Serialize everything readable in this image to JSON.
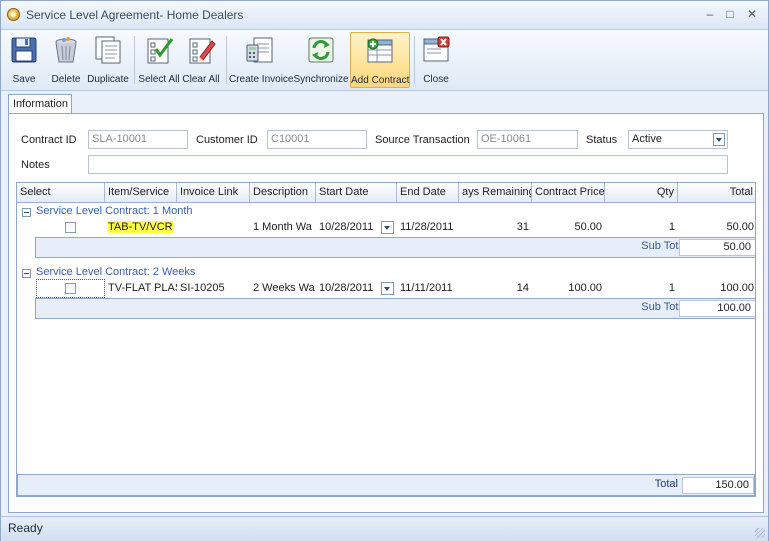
{
  "window": {
    "title": "Service Level Agreement- Home Dealers",
    "controls": {
      "minimize": "–",
      "maximize": "□",
      "close": "✕"
    }
  },
  "toolbar": {
    "buttons": [
      {
        "label": "Save",
        "icon": "save-icon"
      },
      {
        "label": "Delete",
        "icon": "trash-icon"
      },
      {
        "label": "Duplicate",
        "icon": "duplicate-icon"
      },
      {
        "label": "Select All",
        "icon": "select-all-icon"
      },
      {
        "label": "Clear All",
        "icon": "clear-all-icon"
      },
      {
        "label": "Create Invoice",
        "icon": "create-invoice-icon"
      },
      {
        "label": "Synchronize",
        "icon": "synchronize-icon"
      },
      {
        "label": "Add Contract",
        "icon": "add-contract-icon"
      },
      {
        "label": "Close",
        "icon": "close-form-icon"
      }
    ],
    "active": "Add Contract"
  },
  "tabs": [
    {
      "label": "Information"
    }
  ],
  "form": {
    "contract_id_label": "Contract ID",
    "contract_id": "SLA-10001",
    "customer_id_label": "Customer ID",
    "customer_id": "C10001",
    "source_transaction_label": "Source Transaction",
    "source_transaction": "OE-10061",
    "status_label": "Status",
    "status": "Active",
    "notes_label": "Notes",
    "notes": ""
  },
  "grid": {
    "columns": [
      "Select",
      "Item/Service",
      "Invoice Link",
      "Description",
      "Start Date",
      "End Date",
      "ays Remaining",
      "Contract Price",
      "Qty",
      "Total"
    ],
    "groups": [
      {
        "title": "Service Level Contract: 1 Month",
        "rows": [
          {
            "item": "TAB-TV/VCR",
            "invoice_link": "",
            "description": "1 Month Wa",
            "start_date": "10/28/2011",
            "end_date": "11/28/2011",
            "days_remaining": "31",
            "contract_price": "50.00",
            "qty": "1",
            "total": "50.00"
          }
        ],
        "subtotal_label": "Sub Total:",
        "subtotal": "50.00"
      },
      {
        "title": "Service Level Contract: 2 Weeks",
        "rows": [
          {
            "item": "TV-FLAT PLAS",
            "invoice_link": "SI-10205",
            "description": "2 Weeks Wa",
            "start_date": "10/28/2011",
            "end_date": "11/11/2011",
            "days_remaining": "14",
            "contract_price": "100.00",
            "qty": "1",
            "total": "100.00"
          }
        ],
        "subtotal_label": "Sub Total:",
        "subtotal": "100.00"
      }
    ],
    "total_label": "Total",
    "total": "150.00"
  },
  "status_bar": {
    "text": "Ready"
  },
  "colors": {
    "highlight": "#ffff44",
    "group_title": "#3a62a8",
    "active_button": "#ffd77a"
  }
}
